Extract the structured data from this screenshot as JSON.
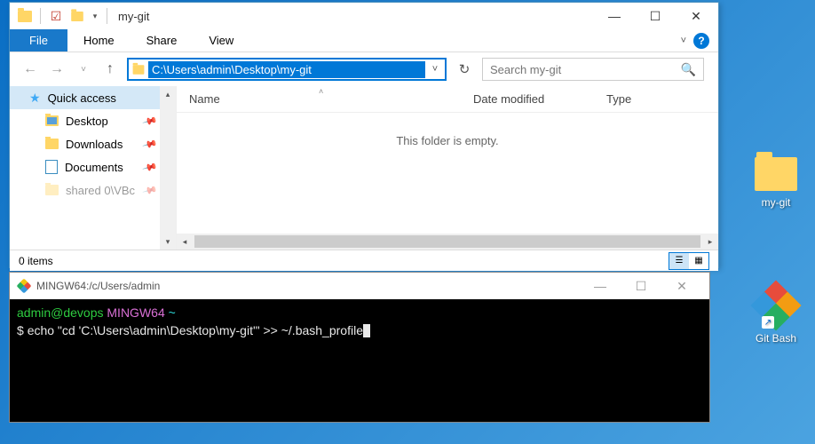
{
  "explorer": {
    "title": "my-git",
    "tabs": {
      "file": "File",
      "home": "Home",
      "share": "Share",
      "view": "View"
    },
    "address": "C:\\Users\\admin\\Desktop\\my-git",
    "search_placeholder": "Search my-git",
    "columns": {
      "name": "Name",
      "date": "Date modified",
      "type": "Type"
    },
    "empty": "This folder is empty.",
    "status": "0 items",
    "sidebar": {
      "quick_access": "Quick access",
      "items": [
        {
          "label": "Desktop",
          "icon": "desktop",
          "pinned": true
        },
        {
          "label": "Downloads",
          "icon": "downloads",
          "pinned": true
        },
        {
          "label": "Documents",
          "icon": "documents",
          "pinned": true
        },
        {
          "label": "shared 0\\VBc",
          "icon": "folder",
          "pinned": true
        }
      ]
    }
  },
  "terminal": {
    "title": "MINGW64:/c/Users/admin",
    "prompt_user": "admin@devops",
    "prompt_env": "MINGW64",
    "prompt_path": "~",
    "command": "echo \"cd 'C:\\Users\\admin\\Desktop\\my-git'\" >> ~/.bash_profile"
  },
  "desktop": {
    "folder_label": "my-git",
    "gitbash_label": "Git Bash"
  }
}
